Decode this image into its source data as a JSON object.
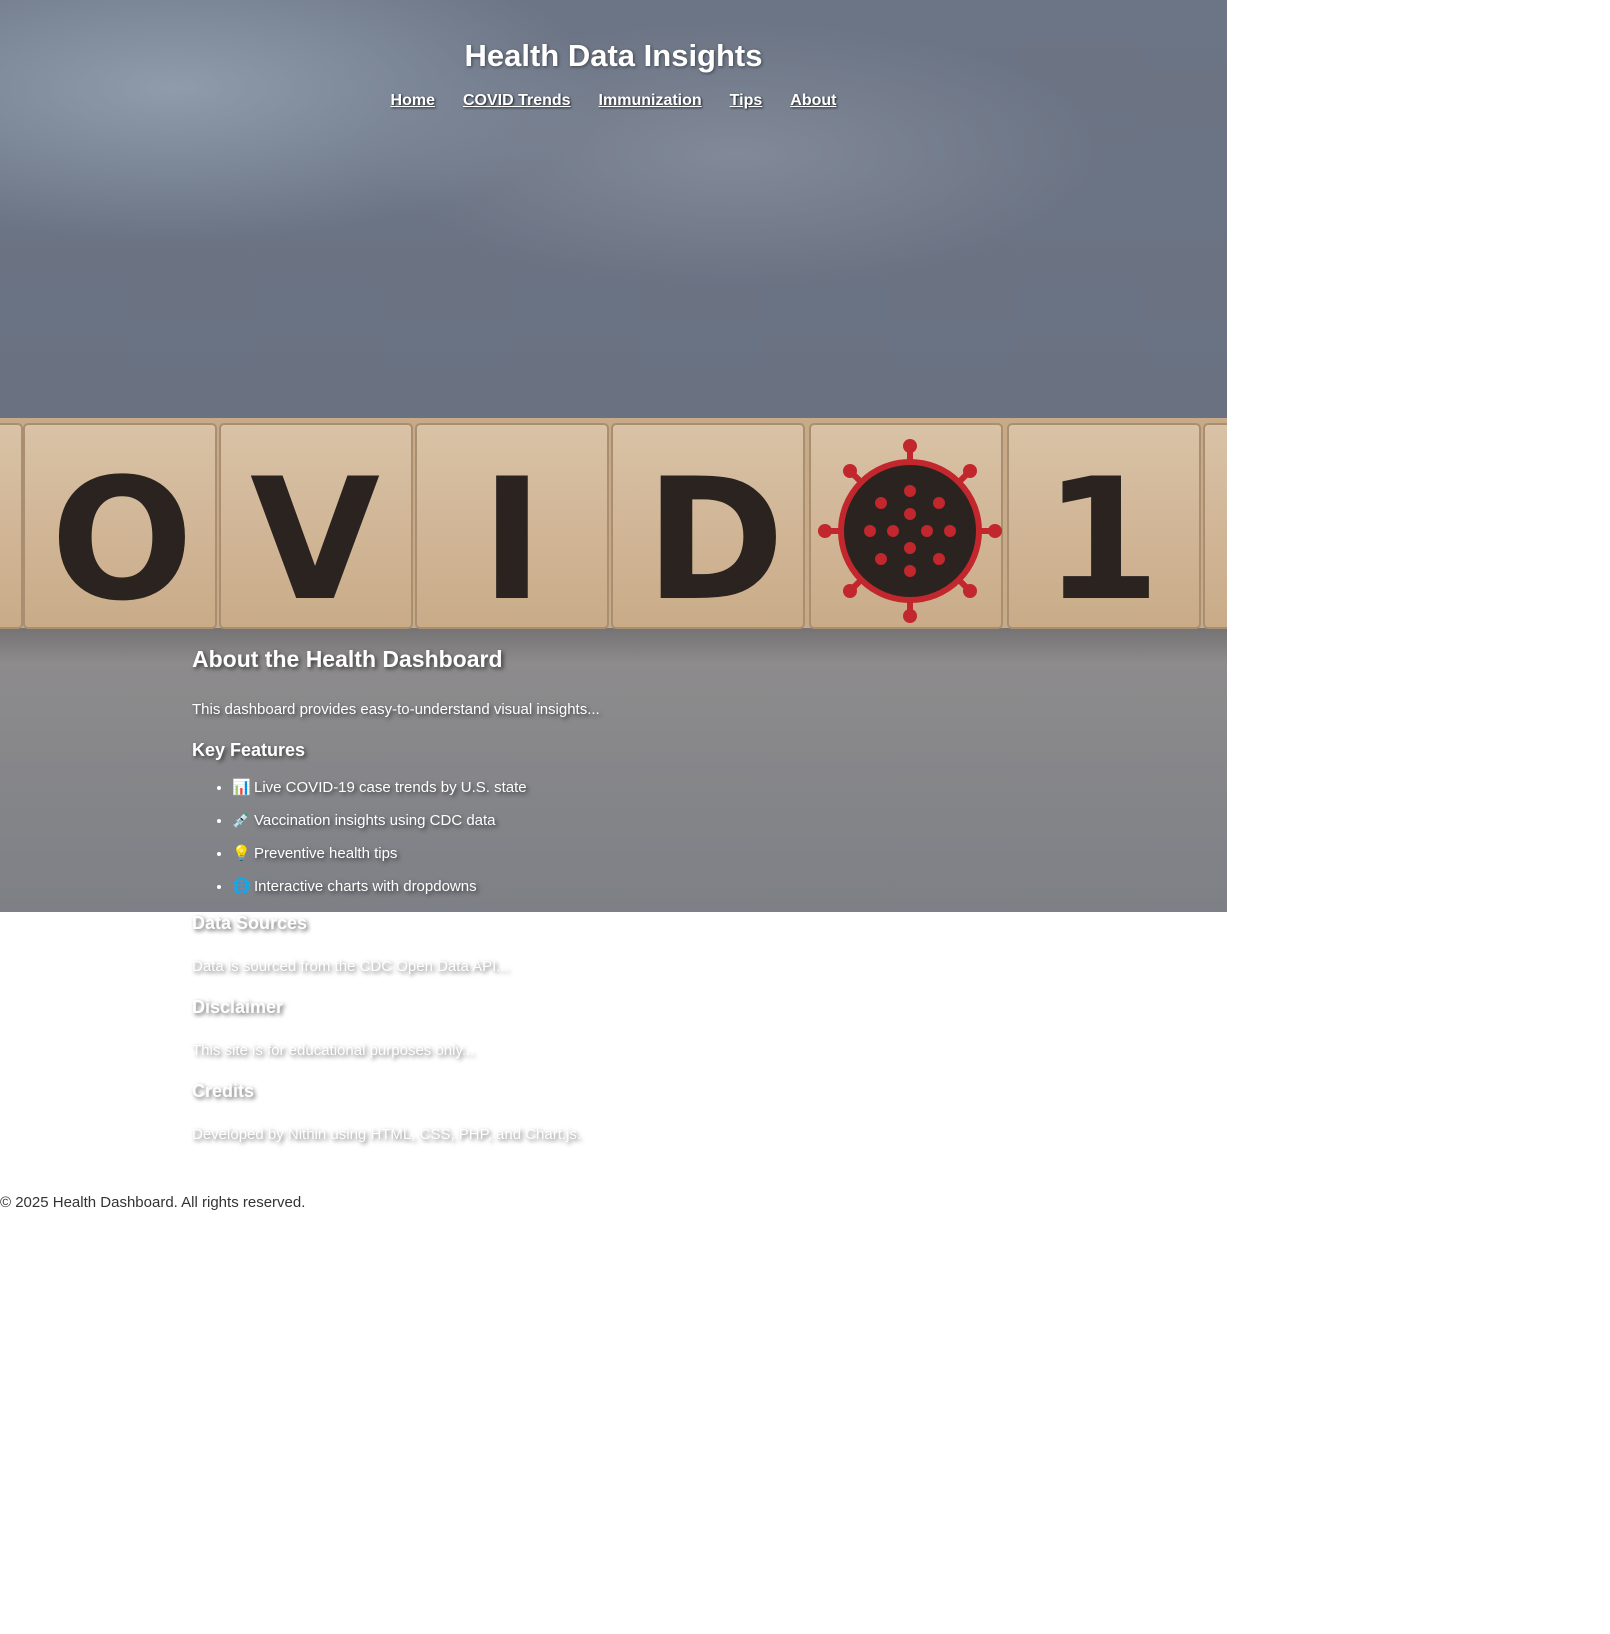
{
  "header": {
    "title": "Health Data Insights"
  },
  "nav": {
    "items": [
      {
        "label": "Home"
      },
      {
        "label": "COVID Trends"
      },
      {
        "label": "Immunization"
      },
      {
        "label": "Tips"
      },
      {
        "label": "About"
      }
    ]
  },
  "hero": {
    "block_letters": [
      "O",
      "V",
      "I",
      "D",
      "1"
    ],
    "colors": {
      "sky_dark": "#5e6778",
      "sky_light": "#8a96a6",
      "block": "#d6bc9c",
      "letter": "#2a2320",
      "virus": "#c1272d",
      "floor": "#8b8a8c"
    }
  },
  "main": {
    "title": "About the Health Dashboard",
    "intro": "This dashboard provides easy-to-understand visual insights...",
    "features_title": "Key Features",
    "features": [
      {
        "icon": "bar-chart-icon",
        "emoji": "📊",
        "text": "Live COVID-19 case trends by U.S. state"
      },
      {
        "icon": "syringe-icon",
        "emoji": "💉",
        "text": "Vaccination insights using CDC data"
      },
      {
        "icon": "lightbulb-icon",
        "emoji": "💡",
        "text": "Preventive health tips"
      },
      {
        "icon": "globe-icon",
        "emoji": "🌐",
        "text": "Interactive charts with dropdowns"
      }
    ],
    "data_sources_title": "Data Sources",
    "data_sources_text": "Data is sourced from the CDC Open Data API...",
    "disclaimer_title": "Disclaimer",
    "disclaimer_text": "This site is for educational purposes only...",
    "credits_title": "Credits",
    "credits_text": "Developed by Nithin using HTML, CSS, PHP, and Chart.js."
  },
  "footer": {
    "text": "© 2025 Health Dashboard. All rights reserved."
  }
}
